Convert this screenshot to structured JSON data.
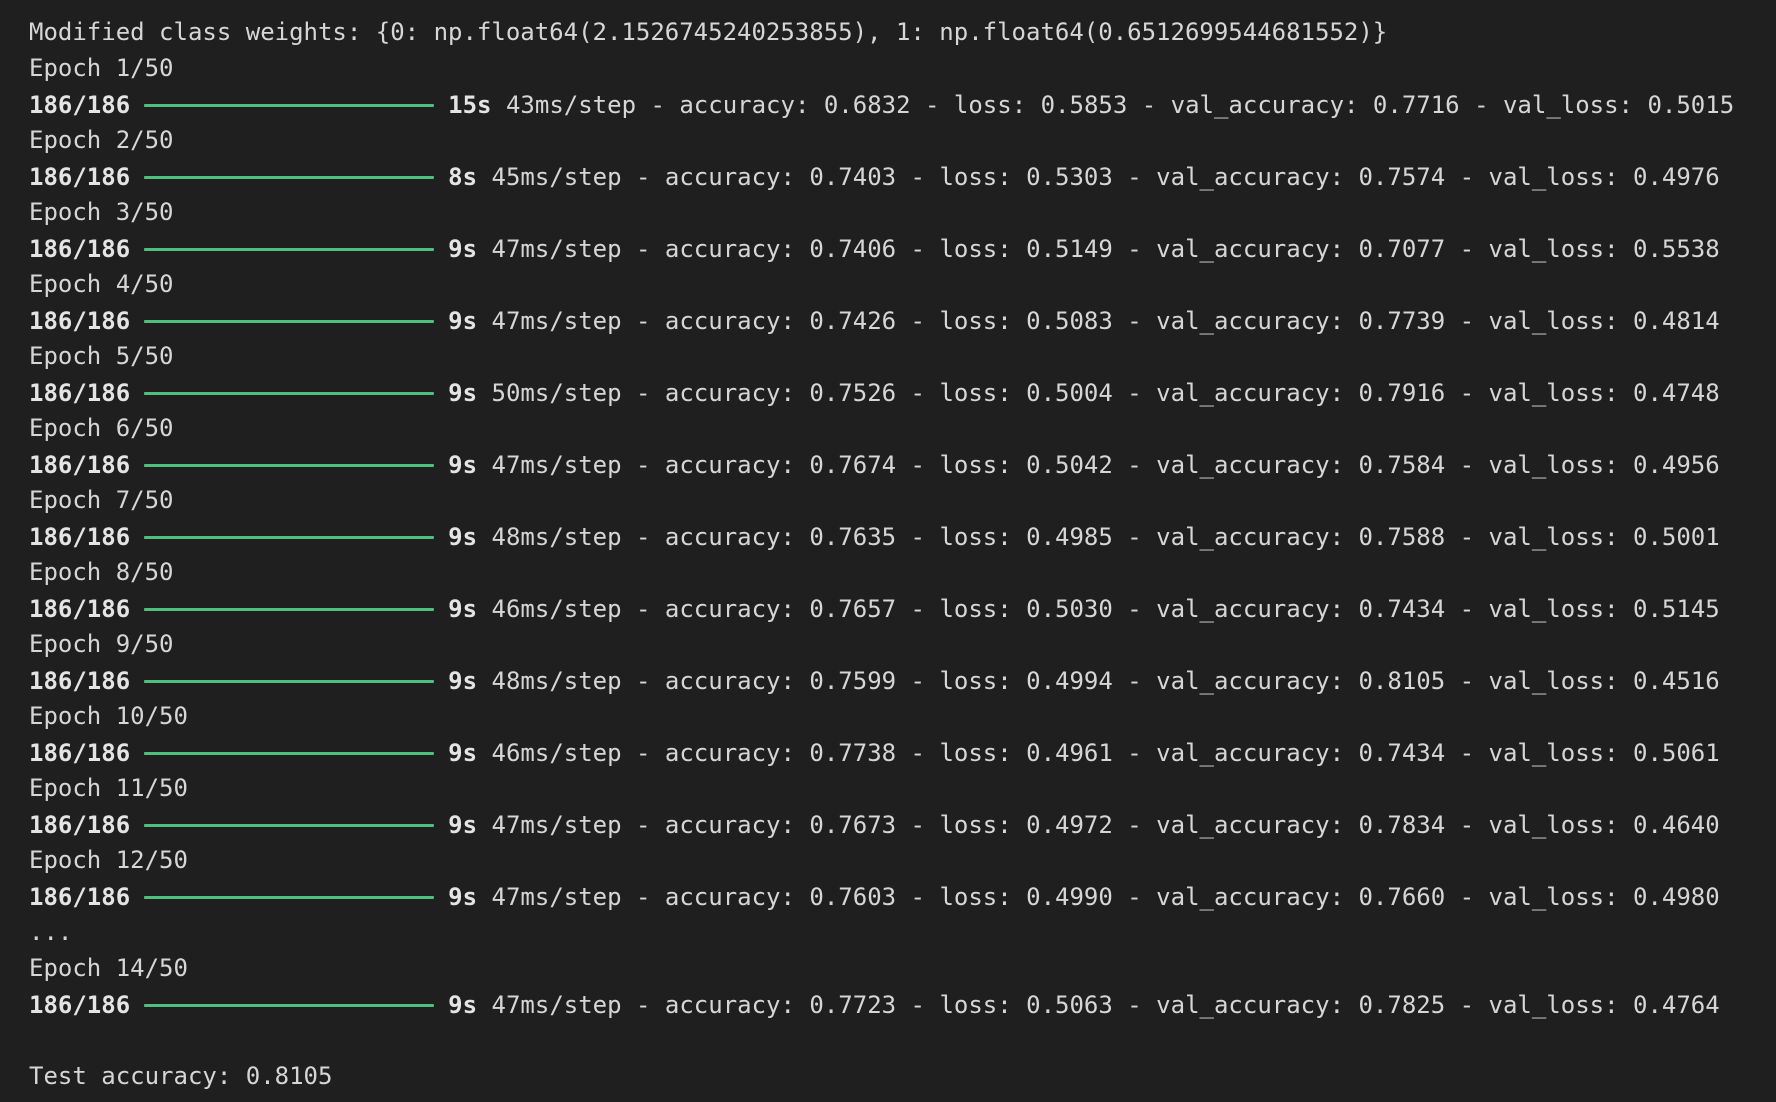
{
  "terminal": {
    "class_weights_line": "Modified class weights: {0: np.float64(2.1526745240253855), 1: np.float64(0.6512699544681552)}",
    "epochs": [
      {
        "label": "Epoch 1/50",
        "steps": "186/186",
        "progress": 1.0,
        "time": "15s",
        "metrics": "43ms/step - accuracy: 0.6832 - loss: 0.5853 - val_accuracy: 0.7716 - val_loss: 0.5015"
      },
      {
        "label": "Epoch 2/50",
        "steps": "186/186",
        "progress": 1.0,
        "time": "8s",
        "metrics": "45ms/step - accuracy: 0.7403 - loss: 0.5303 - val_accuracy: 0.7574 - val_loss: 0.4976"
      },
      {
        "label": "Epoch 3/50",
        "steps": "186/186",
        "progress": 1.0,
        "time": "9s",
        "metrics": "47ms/step - accuracy: 0.7406 - loss: 0.5149 - val_accuracy: 0.7077 - val_loss: 0.5538"
      },
      {
        "label": "Epoch 4/50",
        "steps": "186/186",
        "progress": 1.0,
        "time": "9s",
        "metrics": "47ms/step - accuracy: 0.7426 - loss: 0.5083 - val_accuracy: 0.7739 - val_loss: 0.4814"
      },
      {
        "label": "Epoch 5/50",
        "steps": "186/186",
        "progress": 1.0,
        "time": "9s",
        "metrics": "50ms/step - accuracy: 0.7526 - loss: 0.5004 - val_accuracy: 0.7916 - val_loss: 0.4748"
      },
      {
        "label": "Epoch 6/50",
        "steps": "186/186",
        "progress": 1.0,
        "time": "9s",
        "metrics": "47ms/step - accuracy: 0.7674 - loss: 0.5042 - val_accuracy: 0.7584 - val_loss: 0.4956"
      },
      {
        "label": "Epoch 7/50",
        "steps": "186/186",
        "progress": 1.0,
        "time": "9s",
        "metrics": "48ms/step - accuracy: 0.7635 - loss: 0.4985 - val_accuracy: 0.7588 - val_loss: 0.5001"
      },
      {
        "label": "Epoch 8/50",
        "steps": "186/186",
        "progress": 1.0,
        "time": "9s",
        "metrics": "46ms/step - accuracy: 0.7657 - loss: 0.5030 - val_accuracy: 0.7434 - val_loss: 0.5145"
      },
      {
        "label": "Epoch 9/50",
        "steps": "186/186",
        "progress": 1.0,
        "time": "9s",
        "metrics": "48ms/step - accuracy: 0.7599 - loss: 0.4994 - val_accuracy: 0.8105 - val_loss: 0.4516"
      },
      {
        "label": "Epoch 10/50",
        "steps": "186/186",
        "progress": 1.0,
        "time": "9s",
        "metrics": "46ms/step - accuracy: 0.7738 - loss: 0.4961 - val_accuracy: 0.7434 - val_loss: 0.5061"
      },
      {
        "label": "Epoch 11/50",
        "steps": "186/186",
        "progress": 1.0,
        "time": "9s",
        "metrics": "47ms/step - accuracy: 0.7673 - loss: 0.4972 - val_accuracy: 0.7834 - val_loss: 0.4640"
      },
      {
        "label": "Epoch 12/50",
        "steps": "186/186",
        "progress": 1.0,
        "time": "9s",
        "metrics": "47ms/step - accuracy: 0.7603 - loss: 0.4990 - val_accuracy: 0.7660 - val_loss: 0.4980"
      }
    ],
    "ellipsis": "...",
    "last_epoch": {
      "label": "Epoch 14/50",
      "steps": "186/186",
      "progress": 1.0,
      "time": "9s",
      "metrics": "47ms/step - accuracy: 0.7723 - loss: 0.5063 - val_accuracy: 0.7825 - val_loss: 0.4764"
    },
    "test_result": "Test accuracy: 0.8105"
  },
  "colors": {
    "background": "#1f1f1f",
    "text": "#d6d6d6",
    "progress_bar": "#4fbf7d"
  }
}
